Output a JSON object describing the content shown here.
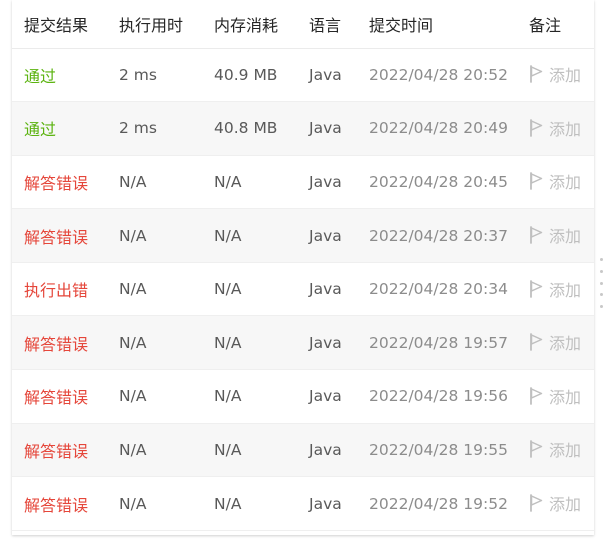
{
  "table": {
    "headers": [
      "提交结果",
      "执行用时",
      "内存消耗",
      "语言",
      "提交时间",
      "备注"
    ],
    "rows": [
      {
        "status": "通过",
        "status_kind": "accepted",
        "runtime": "2 ms",
        "memory": "40.9 MB",
        "language": "Java",
        "submitted": "2022/04/28 20:52",
        "note": "添加"
      },
      {
        "status": "通过",
        "status_kind": "accepted",
        "runtime": "2 ms",
        "memory": "40.8 MB",
        "language": "Java",
        "submitted": "2022/04/28 20:49",
        "note": "添加"
      },
      {
        "status": "解答错误",
        "status_kind": "wrong",
        "runtime": "N/A",
        "memory": "N/A",
        "language": "Java",
        "submitted": "2022/04/28 20:45",
        "note": "添加"
      },
      {
        "status": "解答错误",
        "status_kind": "wrong",
        "runtime": "N/A",
        "memory": "N/A",
        "language": "Java",
        "submitted": "2022/04/28 20:37",
        "note": "添加"
      },
      {
        "status": "执行出错",
        "status_kind": "error",
        "runtime": "N/A",
        "memory": "N/A",
        "language": "Java",
        "submitted": "2022/04/28 20:34",
        "note": "添加"
      },
      {
        "status": "解答错误",
        "status_kind": "wrong",
        "runtime": "N/A",
        "memory": "N/A",
        "language": "Java",
        "submitted": "2022/04/28 19:57",
        "note": "添加"
      },
      {
        "status": "解答错误",
        "status_kind": "wrong",
        "runtime": "N/A",
        "memory": "N/A",
        "language": "Java",
        "submitted": "2022/04/28 19:56",
        "note": "添加"
      },
      {
        "status": "解答错误",
        "status_kind": "wrong",
        "runtime": "N/A",
        "memory": "N/A",
        "language": "Java",
        "submitted": "2022/04/28 19:55",
        "note": "添加"
      },
      {
        "status": "解答错误",
        "status_kind": "wrong",
        "runtime": "N/A",
        "memory": "N/A",
        "language": "Java",
        "submitted": "2022/04/28 19:52",
        "note": "添加"
      }
    ],
    "note_icon": "flag-icon"
  },
  "colors": {
    "accepted": "#5bb30f",
    "wrong": "#e5463a",
    "error": "#e5463a",
    "muted": "#bfbfbf"
  }
}
